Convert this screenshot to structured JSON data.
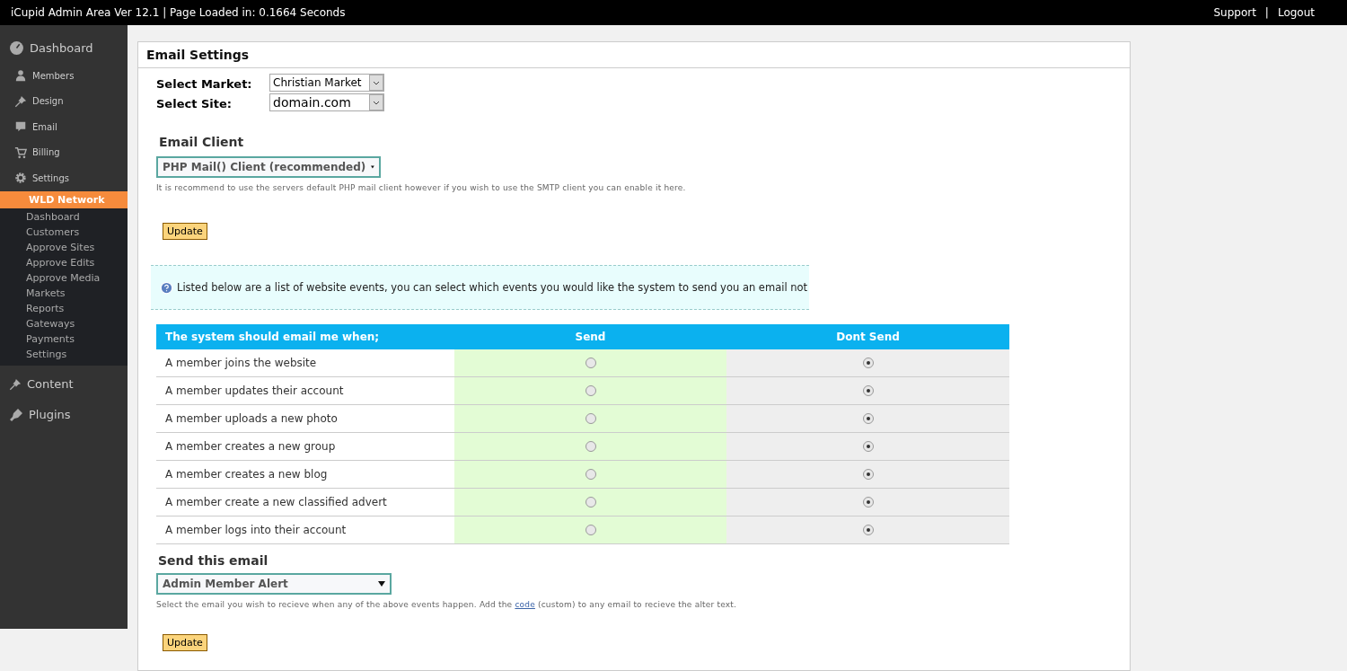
{
  "topbar": {
    "title": "iCupid Admin Area Ver 12.1 | Page Loaded in: 0.1664 Seconds",
    "links": [
      {
        "label": "Support"
      },
      {
        "label": "Logout"
      }
    ],
    "separator": "|"
  },
  "sidebar": {
    "items": [
      {
        "label": "Dashboard",
        "kind": "main"
      },
      {
        "label": "Members",
        "kind": "sub"
      },
      {
        "label": "Design",
        "kind": "sub"
      },
      {
        "label": "Email",
        "kind": "sub"
      },
      {
        "label": "Billing",
        "kind": "sub"
      },
      {
        "label": "Settings",
        "kind": "sub"
      },
      {
        "label": "WLD Network",
        "kind": "section",
        "children": [
          {
            "label": "Dashboard"
          },
          {
            "label": "Customers"
          },
          {
            "label": "Approve Sites"
          },
          {
            "label": "Approve Edits"
          },
          {
            "label": "Approve Media"
          },
          {
            "label": "Markets"
          },
          {
            "label": "Reports"
          },
          {
            "label": "Gateways"
          },
          {
            "label": "Payments"
          },
          {
            "label": "Settings"
          }
        ]
      },
      {
        "label": "Content",
        "kind": "main"
      },
      {
        "label": "Plugins",
        "kind": "main"
      }
    ]
  },
  "panel": {
    "title": "Email Settings",
    "market": {
      "label": "Select Market:",
      "value": "Christian Market"
    },
    "site": {
      "label": "Select Site:",
      "value": "domain.com"
    },
    "email_client": {
      "heading": "Email Client",
      "value": "PHP Mail() Client (recommended)",
      "help": "It is recommend to use the servers default PHP mail client however if you wish to use the SMTP client you can enable it here.",
      "button": "Update"
    },
    "notice": "Listed below are a list of website events, you can select which events you would like the system to send you an email not",
    "table": {
      "columns": [
        "The system should email me when;",
        "Send",
        "Dont Send"
      ],
      "rows": [
        {
          "event": "A member joins the website",
          "send": false
        },
        {
          "event": "A member updates their account",
          "send": false
        },
        {
          "event": "A member uploads a new photo",
          "send": false
        },
        {
          "event": "A member creates a new group",
          "send": false
        },
        {
          "event": "A member creates a new blog",
          "send": false
        },
        {
          "event": "A member create a new classified advert",
          "send": false
        },
        {
          "event": "A member logs into their account",
          "send": false
        }
      ]
    },
    "send_email": {
      "heading": "Send this email",
      "value": "Admin Member Alert",
      "help_before": "Select the email you wish to recieve when any of the above events happen. Add the",
      "help_link": "code",
      "help_after": "(custom) to any email to recieve the alter text.",
      "button": "Update"
    }
  }
}
